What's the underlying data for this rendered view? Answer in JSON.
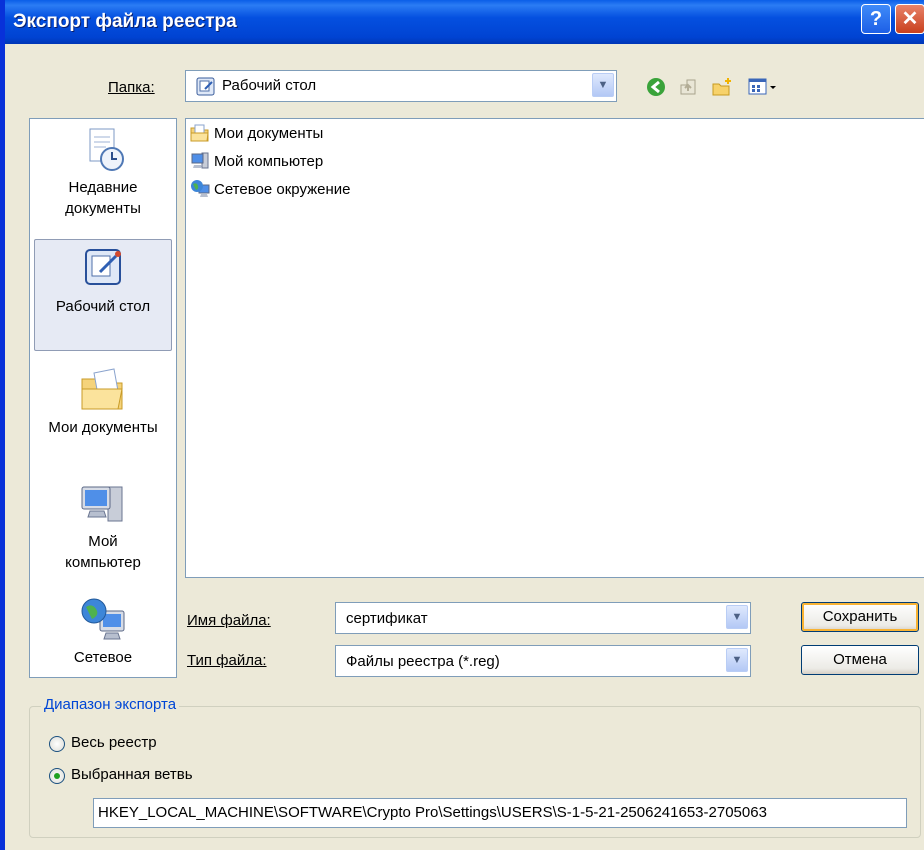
{
  "window": {
    "title": "Экспорт файла реестра",
    "help_label": "?",
    "close_label": "✕"
  },
  "folder": {
    "label": "Папка:",
    "value": "Рабочий стол"
  },
  "places": [
    {
      "name": "recent",
      "label_line1": "Недавние",
      "label_line2": "документы"
    },
    {
      "name": "desktop",
      "label_line1": "Рабочий стол",
      "label_line2": ""
    },
    {
      "name": "mydocs",
      "label_line1": "Мои документы",
      "label_line2": ""
    },
    {
      "name": "mycomp",
      "label_line1": "Мой",
      "label_line2": "компьютер"
    },
    {
      "name": "network",
      "label_line1": "Сетевое",
      "label_line2": ""
    }
  ],
  "files": [
    {
      "label": "Мои документы",
      "icon": "folder-documents-icon"
    },
    {
      "label": "Мой компьютер",
      "icon": "computer-icon"
    },
    {
      "label": "Сетевое окружение",
      "icon": "network-icon"
    }
  ],
  "filename": {
    "label": "Имя файла:",
    "value": "сертификат"
  },
  "filetype": {
    "label": "Тип файла:",
    "value": "Файлы реестра (*.reg)"
  },
  "buttons": {
    "save": "Сохранить",
    "cancel": "Отмена"
  },
  "export_range": {
    "title": "Диапазон экспорта",
    "all_label": "Весь реестр",
    "selected_label": "Выбранная ветвь",
    "selected_value": "selected",
    "branch_path": "HKEY_LOCAL_MACHINE\\SOFTWARE\\Crypto Pro\\Settings\\USERS\\S-1-5-21-2506241653-2705063"
  },
  "colors": {
    "titlebar": "#0450e0",
    "dialog_bg": "#ece9d8",
    "accent_blue": "#0046d5"
  }
}
